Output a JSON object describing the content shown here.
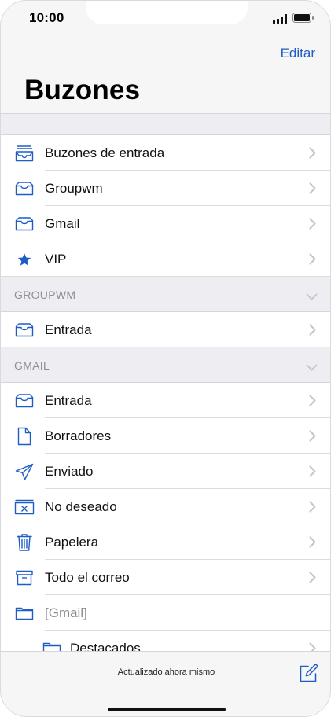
{
  "status_bar": {
    "time": "10:00"
  },
  "header": {
    "edit_label": "Editar",
    "title": "Buzones"
  },
  "mailboxes": [
    {
      "label": "Buzones de entrada",
      "icon": "inbox-stack-icon"
    },
    {
      "label": "Groupwm",
      "icon": "inbox-icon"
    },
    {
      "label": "Gmail",
      "icon": "inbox-icon"
    },
    {
      "label": "VIP",
      "icon": "star-icon"
    }
  ],
  "groupwm": {
    "title": "GROUPWM",
    "items": [
      {
        "label": "Entrada",
        "icon": "inbox-icon"
      }
    ]
  },
  "gmail": {
    "title": "GMAIL",
    "items": [
      {
        "label": "Entrada",
        "icon": "inbox-icon"
      },
      {
        "label": "Borradores",
        "icon": "document-icon"
      },
      {
        "label": "Enviado",
        "icon": "paper-plane-icon"
      },
      {
        "label": "No deseado",
        "icon": "junk-icon"
      },
      {
        "label": "Papelera",
        "icon": "trash-icon"
      },
      {
        "label": "Todo el correo",
        "icon": "archive-icon"
      },
      {
        "label": "[Gmail]",
        "icon": "folder-icon"
      },
      {
        "label": "Destacados",
        "icon": "folder-icon"
      }
    ]
  },
  "toolbar": {
    "status": "Actualizado ahora mismo"
  },
  "colors": {
    "accent": "#1e5cc8",
    "chevron": "#c4c4c9",
    "section_bg": "#eeeef2"
  }
}
